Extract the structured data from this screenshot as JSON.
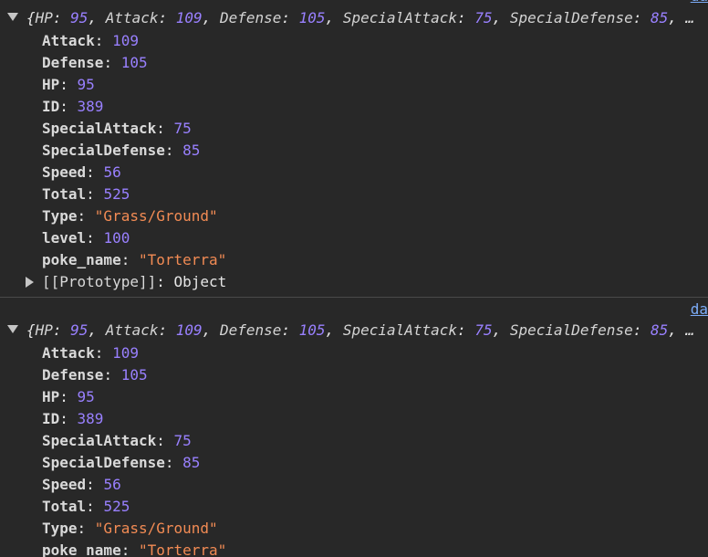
{
  "entries": [
    {
      "source": "da",
      "summary": {
        "open": "{",
        "items": [
          {
            "key": "HP",
            "value": "95"
          },
          {
            "key": "Attack",
            "value": "109"
          },
          {
            "key": "Defense",
            "value": "105"
          },
          {
            "key": "SpecialAttack",
            "value": "75"
          },
          {
            "key": "SpecialDefense",
            "value": "85"
          }
        ],
        "ellipsis": "…"
      },
      "props": [
        {
          "key": "Attack",
          "value": "109",
          "kind": "number"
        },
        {
          "key": "Defense",
          "value": "105",
          "kind": "number"
        },
        {
          "key": "HP",
          "value": "95",
          "kind": "number"
        },
        {
          "key": "ID",
          "value": "389",
          "kind": "number"
        },
        {
          "key": "SpecialAttack",
          "value": "75",
          "kind": "number"
        },
        {
          "key": "SpecialDefense",
          "value": "85",
          "kind": "number"
        },
        {
          "key": "Speed",
          "value": "56",
          "kind": "number"
        },
        {
          "key": "Total",
          "value": "525",
          "kind": "number"
        },
        {
          "key": "Type",
          "value": "\"Grass/Ground\"",
          "kind": "string"
        },
        {
          "key": "level",
          "value": "100",
          "kind": "number"
        },
        {
          "key": "poke_name",
          "value": "\"Torterra\"",
          "kind": "string"
        }
      ],
      "prototype": {
        "key": "[[Prototype]]",
        "value": "Object"
      }
    },
    {
      "source": "da",
      "summary": {
        "open": "{",
        "items": [
          {
            "key": "HP",
            "value": "95"
          },
          {
            "key": "Attack",
            "value": "109"
          },
          {
            "key": "Defense",
            "value": "105"
          },
          {
            "key": "SpecialAttack",
            "value": "75"
          },
          {
            "key": "SpecialDefense",
            "value": "85"
          }
        ],
        "ellipsis": "…"
      },
      "props": [
        {
          "key": "Attack",
          "value": "109",
          "kind": "number"
        },
        {
          "key": "Defense",
          "value": "105",
          "kind": "number"
        },
        {
          "key": "HP",
          "value": "95",
          "kind": "number"
        },
        {
          "key": "ID",
          "value": "389",
          "kind": "number"
        },
        {
          "key": "SpecialAttack",
          "value": "75",
          "kind": "number"
        },
        {
          "key": "SpecialDefense",
          "value": "85",
          "kind": "number"
        },
        {
          "key": "Speed",
          "value": "56",
          "kind": "number"
        },
        {
          "key": "Total",
          "value": "525",
          "kind": "number"
        },
        {
          "key": "Type",
          "value": "\"Grass/Ground\"",
          "kind": "string"
        },
        {
          "key": "poke_name",
          "value": "\"Torterra\"",
          "kind": "string"
        }
      ]
    }
  ],
  "colors": {
    "background": "#282828",
    "number": "#9980ff",
    "string": "#f28b54",
    "link": "#7cacf8"
  },
  "icons": {
    "expanded": "triangle-down-icon",
    "collapsed": "triangle-right-icon"
  }
}
